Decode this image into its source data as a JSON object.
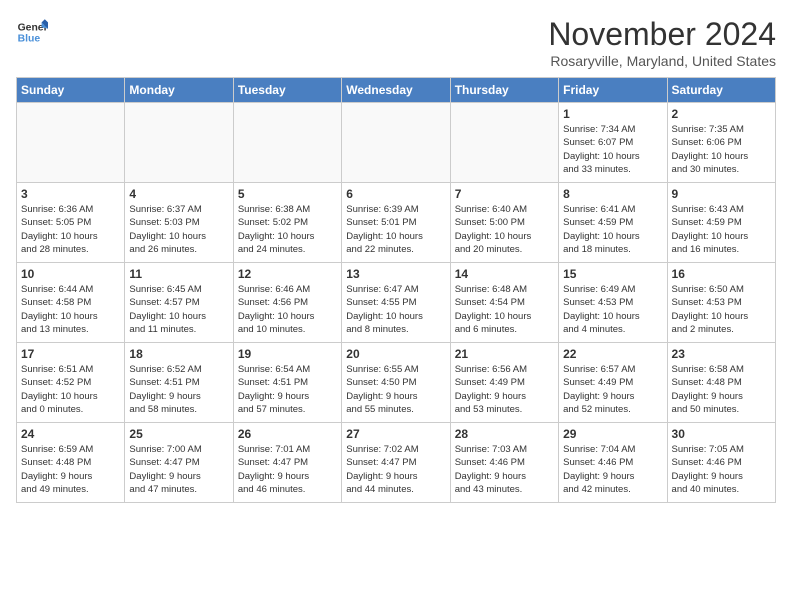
{
  "header": {
    "logo_line1": "General",
    "logo_line2": "Blue",
    "month": "November 2024",
    "location": "Rosaryville, Maryland, United States"
  },
  "weekdays": [
    "Sunday",
    "Monday",
    "Tuesday",
    "Wednesday",
    "Thursday",
    "Friday",
    "Saturday"
  ],
  "weeks": [
    [
      {
        "day": "",
        "info": ""
      },
      {
        "day": "",
        "info": ""
      },
      {
        "day": "",
        "info": ""
      },
      {
        "day": "",
        "info": ""
      },
      {
        "day": "",
        "info": ""
      },
      {
        "day": "1",
        "info": "Sunrise: 7:34 AM\nSunset: 6:07 PM\nDaylight: 10 hours\nand 33 minutes."
      },
      {
        "day": "2",
        "info": "Sunrise: 7:35 AM\nSunset: 6:06 PM\nDaylight: 10 hours\nand 30 minutes."
      }
    ],
    [
      {
        "day": "3",
        "info": "Sunrise: 6:36 AM\nSunset: 5:05 PM\nDaylight: 10 hours\nand 28 minutes."
      },
      {
        "day": "4",
        "info": "Sunrise: 6:37 AM\nSunset: 5:03 PM\nDaylight: 10 hours\nand 26 minutes."
      },
      {
        "day": "5",
        "info": "Sunrise: 6:38 AM\nSunset: 5:02 PM\nDaylight: 10 hours\nand 24 minutes."
      },
      {
        "day": "6",
        "info": "Sunrise: 6:39 AM\nSunset: 5:01 PM\nDaylight: 10 hours\nand 22 minutes."
      },
      {
        "day": "7",
        "info": "Sunrise: 6:40 AM\nSunset: 5:00 PM\nDaylight: 10 hours\nand 20 minutes."
      },
      {
        "day": "8",
        "info": "Sunrise: 6:41 AM\nSunset: 4:59 PM\nDaylight: 10 hours\nand 18 minutes."
      },
      {
        "day": "9",
        "info": "Sunrise: 6:43 AM\nSunset: 4:59 PM\nDaylight: 10 hours\nand 16 minutes."
      }
    ],
    [
      {
        "day": "10",
        "info": "Sunrise: 6:44 AM\nSunset: 4:58 PM\nDaylight: 10 hours\nand 13 minutes."
      },
      {
        "day": "11",
        "info": "Sunrise: 6:45 AM\nSunset: 4:57 PM\nDaylight: 10 hours\nand 11 minutes."
      },
      {
        "day": "12",
        "info": "Sunrise: 6:46 AM\nSunset: 4:56 PM\nDaylight: 10 hours\nand 10 minutes."
      },
      {
        "day": "13",
        "info": "Sunrise: 6:47 AM\nSunset: 4:55 PM\nDaylight: 10 hours\nand 8 minutes."
      },
      {
        "day": "14",
        "info": "Sunrise: 6:48 AM\nSunset: 4:54 PM\nDaylight: 10 hours\nand 6 minutes."
      },
      {
        "day": "15",
        "info": "Sunrise: 6:49 AM\nSunset: 4:53 PM\nDaylight: 10 hours\nand 4 minutes."
      },
      {
        "day": "16",
        "info": "Sunrise: 6:50 AM\nSunset: 4:53 PM\nDaylight: 10 hours\nand 2 minutes."
      }
    ],
    [
      {
        "day": "17",
        "info": "Sunrise: 6:51 AM\nSunset: 4:52 PM\nDaylight: 10 hours\nand 0 minutes."
      },
      {
        "day": "18",
        "info": "Sunrise: 6:52 AM\nSunset: 4:51 PM\nDaylight: 9 hours\nand 58 minutes."
      },
      {
        "day": "19",
        "info": "Sunrise: 6:54 AM\nSunset: 4:51 PM\nDaylight: 9 hours\nand 57 minutes."
      },
      {
        "day": "20",
        "info": "Sunrise: 6:55 AM\nSunset: 4:50 PM\nDaylight: 9 hours\nand 55 minutes."
      },
      {
        "day": "21",
        "info": "Sunrise: 6:56 AM\nSunset: 4:49 PM\nDaylight: 9 hours\nand 53 minutes."
      },
      {
        "day": "22",
        "info": "Sunrise: 6:57 AM\nSunset: 4:49 PM\nDaylight: 9 hours\nand 52 minutes."
      },
      {
        "day": "23",
        "info": "Sunrise: 6:58 AM\nSunset: 4:48 PM\nDaylight: 9 hours\nand 50 minutes."
      }
    ],
    [
      {
        "day": "24",
        "info": "Sunrise: 6:59 AM\nSunset: 4:48 PM\nDaylight: 9 hours\nand 49 minutes."
      },
      {
        "day": "25",
        "info": "Sunrise: 7:00 AM\nSunset: 4:47 PM\nDaylight: 9 hours\nand 47 minutes."
      },
      {
        "day": "26",
        "info": "Sunrise: 7:01 AM\nSunset: 4:47 PM\nDaylight: 9 hours\nand 46 minutes."
      },
      {
        "day": "27",
        "info": "Sunrise: 7:02 AM\nSunset: 4:47 PM\nDaylight: 9 hours\nand 44 minutes."
      },
      {
        "day": "28",
        "info": "Sunrise: 7:03 AM\nSunset: 4:46 PM\nDaylight: 9 hours\nand 43 minutes."
      },
      {
        "day": "29",
        "info": "Sunrise: 7:04 AM\nSunset: 4:46 PM\nDaylight: 9 hours\nand 42 minutes."
      },
      {
        "day": "30",
        "info": "Sunrise: 7:05 AM\nSunset: 4:46 PM\nDaylight: 9 hours\nand 40 minutes."
      }
    ]
  ]
}
